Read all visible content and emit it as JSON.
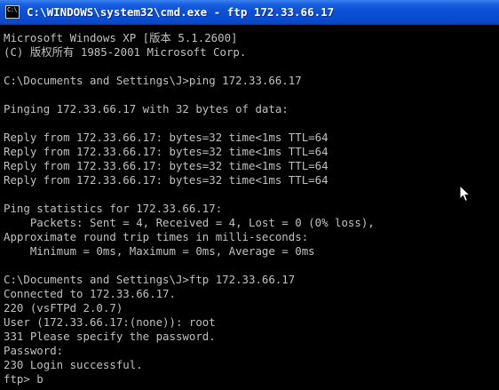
{
  "window": {
    "title": "C:\\WINDOWS\\system32\\cmd.exe - ftp 172.33.66.17",
    "icon_glyph": "C:\\"
  },
  "console": {
    "lines": [
      "Microsoft Windows XP [版本 5.1.2600]",
      "(C) 版权所有 1985-2001 Microsoft Corp.",
      "",
      "C:\\Documents and Settings\\J>ping 172.33.66.17",
      "",
      "Pinging 172.33.66.17 with 32 bytes of data:",
      "",
      "Reply from 172.33.66.17: bytes=32 time<1ms TTL=64",
      "Reply from 172.33.66.17: bytes=32 time<1ms TTL=64",
      "Reply from 172.33.66.17: bytes=32 time<1ms TTL=64",
      "Reply from 172.33.66.17: bytes=32 time<1ms TTL=64",
      "",
      "Ping statistics for 172.33.66.17:",
      "    Packets: Sent = 4, Received = 4, Lost = 0 (0% loss),",
      "Approximate round trip times in milli-seconds:",
      "    Minimum = 0ms, Maximum = 0ms, Average = 0ms",
      "",
      "C:\\Documents and Settings\\J>ftp 172.33.66.17",
      "Connected to 172.33.66.17.",
      "220 (vsFTPd 2.0.7)",
      "User (172.33.66.17:(none)): root",
      "331 Please specify the password.",
      "Password:",
      "230 Login successful.",
      "ftp> b"
    ]
  },
  "icons": {
    "window_icon": "cmd-window-icon",
    "pointer": "mouse-pointer-icon"
  },
  "colors": {
    "titlebar": "#0a4fd6",
    "console_background": "#000000",
    "console_text": "#c0c0c0"
  }
}
